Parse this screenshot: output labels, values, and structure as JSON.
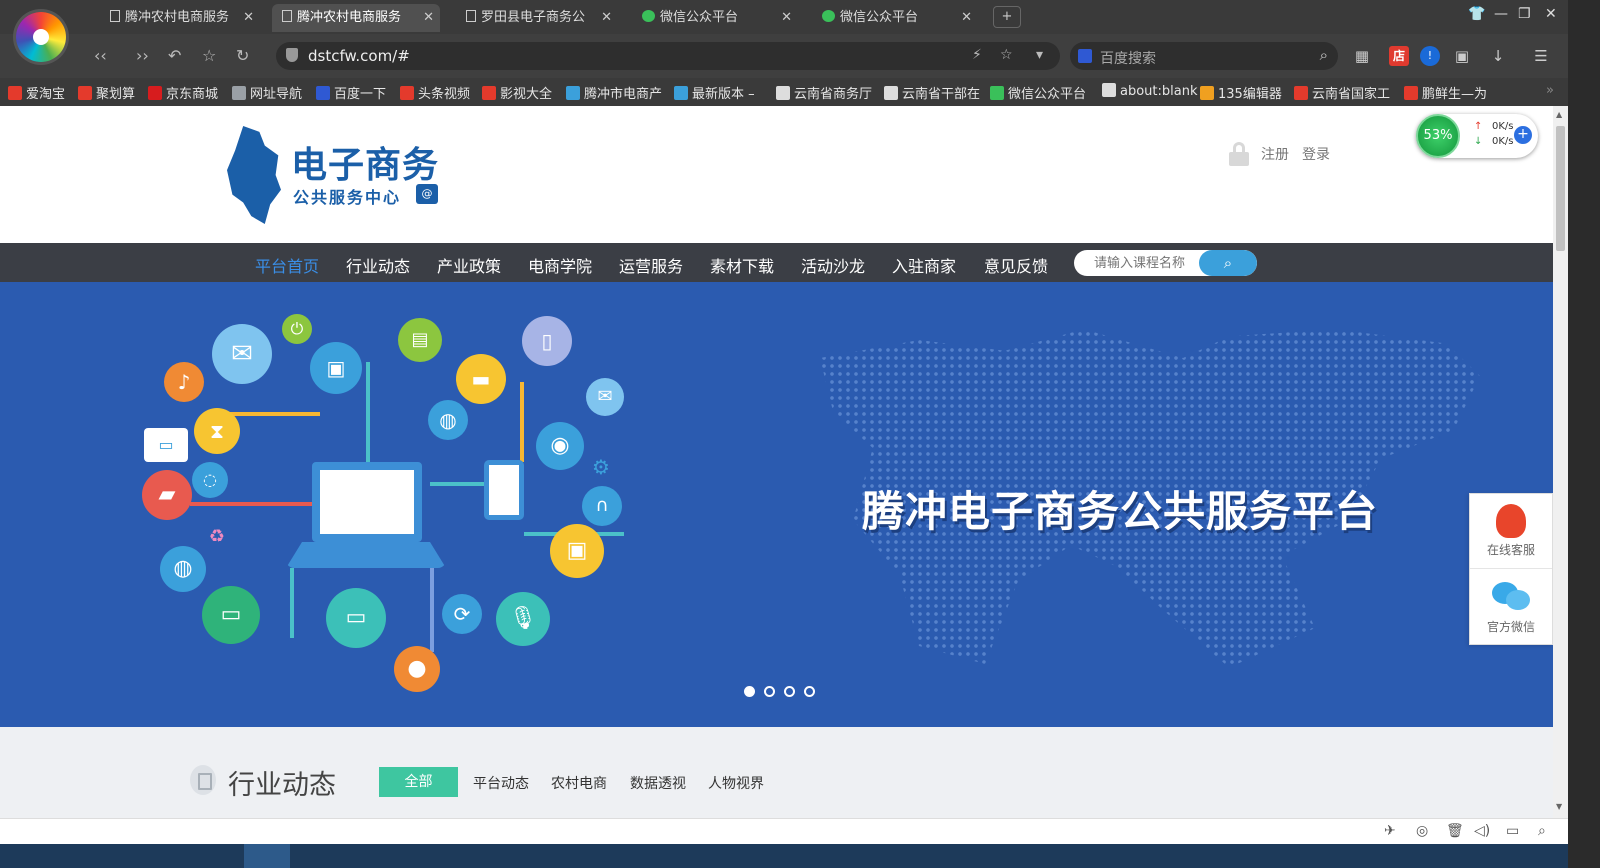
{
  "browser": {
    "tabs": [
      {
        "title": "腾冲农村电商服务",
        "icon": "page-icon"
      },
      {
        "title": "腾冲农村电商服务",
        "icon": "page-icon"
      },
      {
        "title": "罗田县电子商务公",
        "icon": "page-icon"
      },
      {
        "title": "微信公众平台",
        "icon": "wechat-icon"
      },
      {
        "title": "微信公众平台",
        "icon": "wechat-icon"
      }
    ],
    "address": "dstcfw.com/#",
    "search_placeholder": "百度搜索",
    "store_label": "店",
    "bookmarks": [
      {
        "label": "爱淘宝",
        "color": "#e43a2c"
      },
      {
        "label": "聚划算",
        "color": "#e43a2c"
      },
      {
        "label": "京东商城",
        "color": "#d71c1e"
      },
      {
        "label": "网址导航",
        "color": "#9aa0a6"
      },
      {
        "label": "百度一下",
        "color": "#2f59d3"
      },
      {
        "label": "头条视频",
        "color": "#e43a2c"
      },
      {
        "label": "影视大全",
        "color": "#e43a2c"
      },
      {
        "label": "腾冲市电商产",
        "color": "#3ba0db"
      },
      {
        "label": "最新版本 –",
        "color": "#3ba0db"
      },
      {
        "label": "云南省商务厅",
        "color": "#dddddd"
      },
      {
        "label": "云南省干部在",
        "color": "#dddddd"
      },
      {
        "label": "微信公众平台",
        "color": "#3ac05a"
      },
      {
        "label": "about:blank",
        "color": "#dddddd"
      },
      {
        "label": "135编辑器",
        "color": "#f0a020"
      },
      {
        "label": "云南省国家工",
        "color": "#e43a2c"
      },
      {
        "label": "鹏鲜生—为",
        "color": "#e43a2c"
      }
    ],
    "speed": {
      "percent": "53%",
      "up": "0K/s",
      "down": "0K/s"
    }
  },
  "header": {
    "logo_title": "电子商务",
    "logo_subtitle": "公共服务中心",
    "logo_badge": "@",
    "register": "注册",
    "login": "登录"
  },
  "nav": {
    "items": [
      "平台首页",
      "行业动态",
      "产业政策",
      "电商学院",
      "运营服务",
      "素材下载",
      "活动沙龙",
      "入驻商家",
      "意见反馈"
    ],
    "active_index": 0,
    "search_placeholder": "请输入课程名称"
  },
  "banner": {
    "title": "腾冲电子商务公共服务平台",
    "slides": 4,
    "active_slide": 0
  },
  "side_widget": {
    "online_service": "在线客服",
    "official_wechat": "官方微信"
  },
  "section": {
    "title": "行业动态",
    "tabs": [
      "全部",
      "平台动态",
      "农村电商",
      "数据透视",
      "人物视界"
    ],
    "active_tab": 0
  },
  "colors": {
    "brand_blue": "#1b5fa8",
    "nav_bg": "#3b3e45",
    "nav_active": "#3a8ee6",
    "banner_bg": "#2b5bb0",
    "tab_active": "#3ec6a0"
  }
}
